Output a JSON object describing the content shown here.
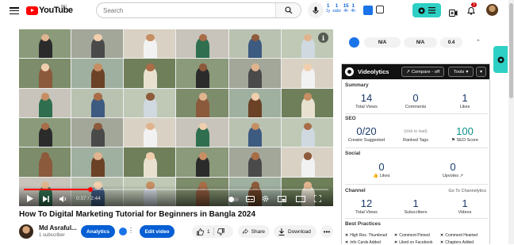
{
  "header": {
    "logo_text": "YouTube",
    "country": "BD",
    "search_placeholder": "Search",
    "ext_stats": [
      {
        "value": "1",
        "label": "1y"
      },
      {
        "value": "1",
        "label": "subs"
      },
      {
        "value": "15",
        "label": "4h"
      },
      {
        "value": "1",
        "label": "4h"
      }
    ],
    "bell_count": "3"
  },
  "player": {
    "time": "0:37 / 2:44",
    "progress_percent": 22
  },
  "video": {
    "title": "How To Digital Marketing Tutorial for Beginners in Bangla 2024",
    "channel_name": "Md Asraful...",
    "subscribers": "1 subscriber",
    "analytics_label": "Analytics",
    "edit_label": "Edit video",
    "like_count": "1",
    "share_label": "Share",
    "download_label": "Download"
  },
  "side_top": {
    "pills": [
      "N/A",
      "N/A",
      "0.4"
    ]
  },
  "videolytics": {
    "brand": "Videolytics",
    "compare_label": "Compare - off",
    "tools_label": "Tools",
    "summary": {
      "title": "Summary",
      "stats": [
        {
          "value": "14",
          "label": "Total Views"
        },
        {
          "value": "0",
          "label": "Comments"
        },
        {
          "value": "1",
          "label": "Likes"
        }
      ]
    },
    "seo": {
      "title": "SEO",
      "creator_tags": "0/20",
      "creator_tags_label": "Creator Suggested",
      "ranked_hint": "(click to load)",
      "ranked_label": "Ranked Tags",
      "score": "100",
      "score_label": "SEO Score"
    },
    "social": {
      "title": "Social",
      "likes": "0",
      "likes_label": "Likes",
      "upvotes": "0",
      "upvotes_label": "Upvotes"
    },
    "channel": {
      "title": "Channel",
      "link": "Go To Channelytics",
      "stats": [
        {
          "value": "12",
          "label": "Total Views"
        },
        {
          "value": "1",
          "label": "Subscribers"
        },
        {
          "value": "1",
          "label": "Videos"
        }
      ]
    },
    "best_practices": {
      "title": "Best Practices",
      "items": [
        "High Res. Thumbnail",
        "Comment Pinned",
        "Comment Hearted",
        "Info Cards Added",
        "Liked on Facebook",
        "Chapters Added"
      ]
    }
  }
}
